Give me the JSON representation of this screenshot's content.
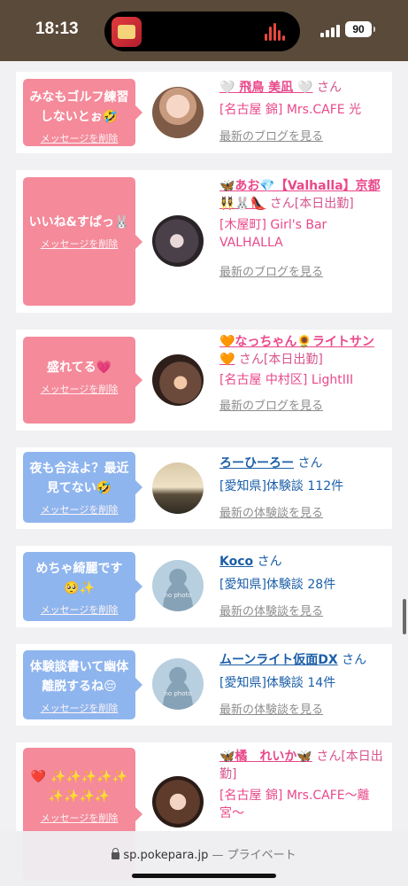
{
  "status": {
    "time": "18:13",
    "battery": "90"
  },
  "url": {
    "domain": "sp.pokepara.jp",
    "suffix": "— プライベート"
  },
  "delete_label": "メッセージを削除",
  "cards": [
    {
      "message": "みなもゴルフ練習しないとぉ🤣",
      "name": "🤍 飛鳥 美凪 🤍",
      "san": "さん",
      "detail": "[名古屋 錦] Mrs.CAFE 光",
      "link": "最新のブログを見る"
    },
    {
      "message": "いいね&すぱっ🐰",
      "name": "🦋あお💎【Valhalla】京都👯‍♀️🐰👠",
      "san": "さん[本日出勤]",
      "detail": "[木屋町] Girl's Bar VALHALLA",
      "link": "最新のブログを見る"
    },
    {
      "message": "盛れてる💗",
      "name": "🧡なっちゃん🌻ライトサン🧡",
      "san": "さん[本日出勤]",
      "detail": "[名古屋 中村区] LightIII",
      "link": "最新のブログを見る"
    },
    {
      "message": "夜も合法よ？最近見てない🤣",
      "name": "ろーひーろー",
      "san": "さん",
      "detail": "[愛知県]体験談 112件",
      "link": "最新の体験談を見る"
    },
    {
      "message": "めちゃ綺麗です🥺✨",
      "name": "Koco",
      "san": "さん",
      "detail": "[愛知県]体験談 28件",
      "link": "最新の体験談を見る",
      "avatar_text": "no photo"
    },
    {
      "message": "体験談書いて幽体離脱するね😔",
      "name": "ムーンライト仮面DX",
      "san": "さん",
      "detail": "[愛知県]体験談 14件",
      "link": "最新の体験談を見る",
      "avatar_text": "no photo"
    },
    {
      "message": "❤️ ✨✨✨✨✨ ✨✨✨✨",
      "name": "🦋橘　れいか🦋",
      "san": "さん[本日出勤]",
      "detail": "[名古屋 錦] Mrs.CAFE〜離宮〜",
      "link": ""
    }
  ],
  "colors": {
    "status_bg": "#5a4a3a",
    "pink_bubble": "#f48a9a",
    "blue_bubble": "#8fb5ee",
    "pink_name": "#e9488a",
    "blue_name": "#1c5fa8",
    "page_bg": "#f1f1f3"
  }
}
